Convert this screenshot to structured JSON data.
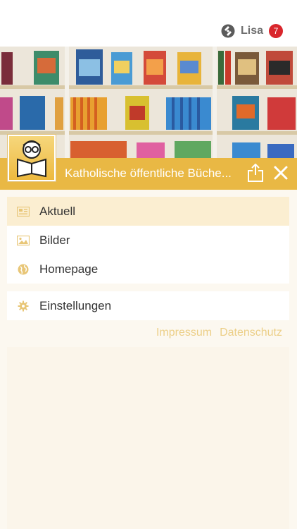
{
  "header": {
    "user_name": "Lisa",
    "notification_count": "7"
  },
  "titlebar": {
    "title": "Katholische öffentliche Büche..."
  },
  "menu": {
    "items": [
      {
        "label": "Aktuell",
        "icon": "newspaper-icon",
        "active": true
      },
      {
        "label": "Bilder",
        "icon": "image-icon",
        "active": false
      },
      {
        "label": "Homepage",
        "icon": "globe-icon",
        "active": false
      }
    ],
    "settings_label": "Einstellungen"
  },
  "footer": {
    "impressum": "Impressum",
    "datenschutz": "Datenschutz"
  },
  "colors": {
    "accent": "#e9b844",
    "badge": "#d9262c",
    "link": "#eccf88",
    "active_bg": "#fbeed1"
  }
}
